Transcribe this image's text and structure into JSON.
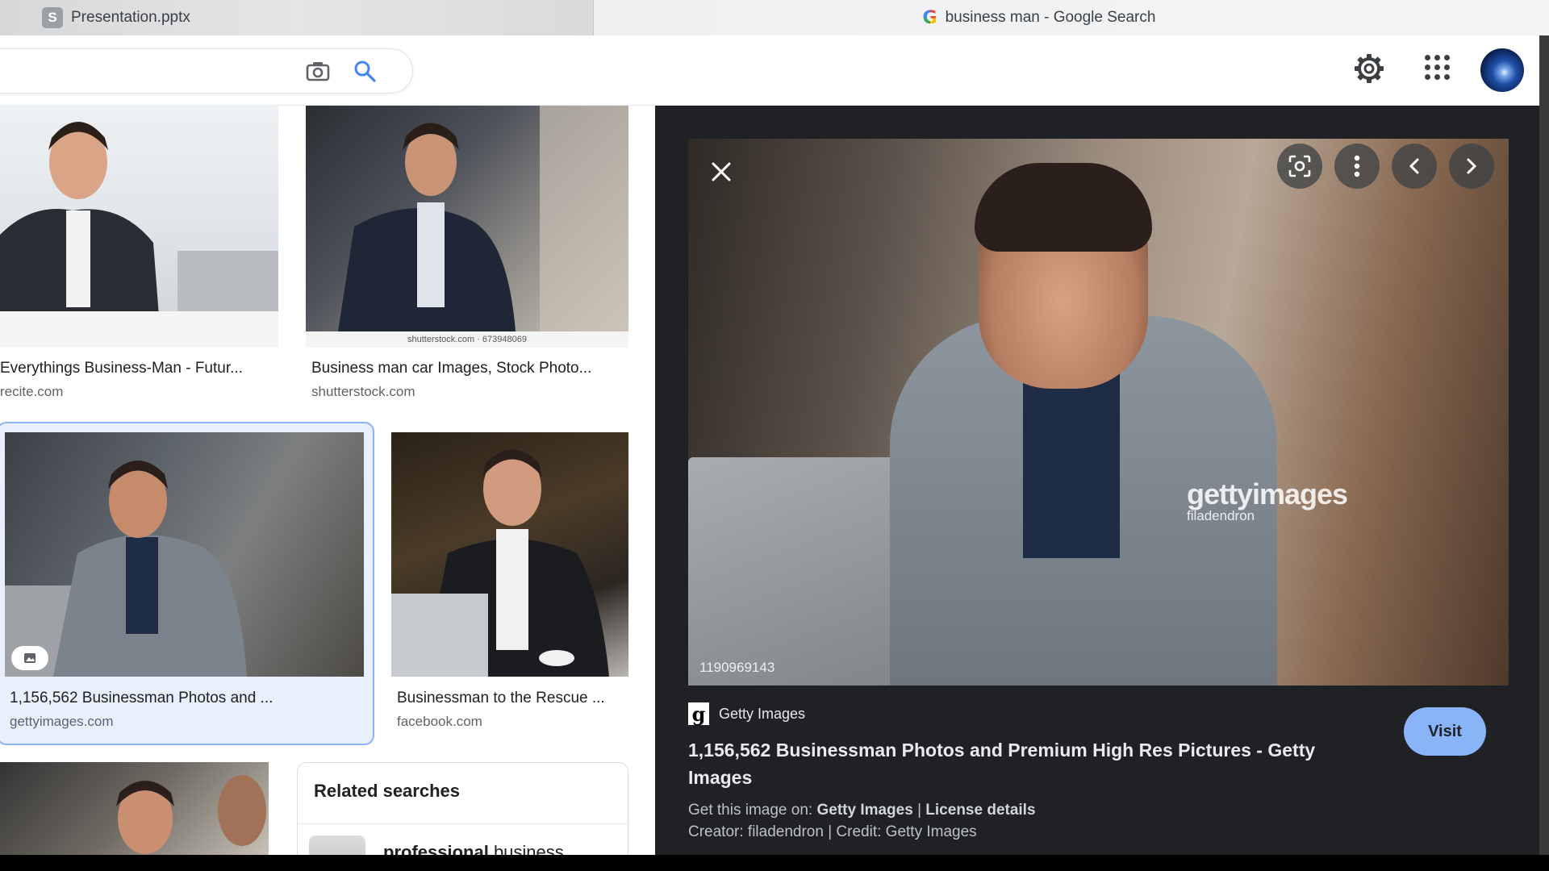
{
  "tabs": {
    "presentation": {
      "badge": "S",
      "title": "Presentation.pptx"
    },
    "google": {
      "title": "business man - Google Search"
    }
  },
  "header": {
    "search_value": "",
    "icons": [
      "camera-icon",
      "search-icon",
      "gear-icon",
      "apps-grid-icon",
      "account-avatar"
    ]
  },
  "results": [
    {
      "title": "Everythings Business-Man - Futur...",
      "source": "recite.com"
    },
    {
      "title": "Business man car Images, Stock Photo...",
      "source": "shutterstock.com",
      "caption": "shutterstock.com · 673948069"
    },
    {
      "title": "1,156,562 Businessman Photos and ...",
      "source": "gettyimages.com",
      "selected": true
    },
    {
      "title": "Businessman to the Rescue ...",
      "source": "facebook.com"
    }
  ],
  "related": {
    "heading": "Related searches",
    "item_bold": "professional",
    "item_rest": "business"
  },
  "preview": {
    "watermark_brand": "gettyimages",
    "watermark_credit": "filadendron",
    "image_id": "1190969143",
    "source_logo": "g",
    "source_name": "Getty Images",
    "title": "1,156,562 Businessman Photos and Premium High Res Pictures - Getty Images",
    "visit_label": "Visit",
    "get_prefix": "Get this image on: ",
    "get_source": "Getty Images",
    "separator": " | ",
    "license": "License details",
    "creator_line": "Creator: filadendron | Credit: Getty Images"
  },
  "colors": {
    "accent": "#8ab4f8",
    "selected_bg": "#e8f0fe",
    "panel_bg": "#202124"
  }
}
